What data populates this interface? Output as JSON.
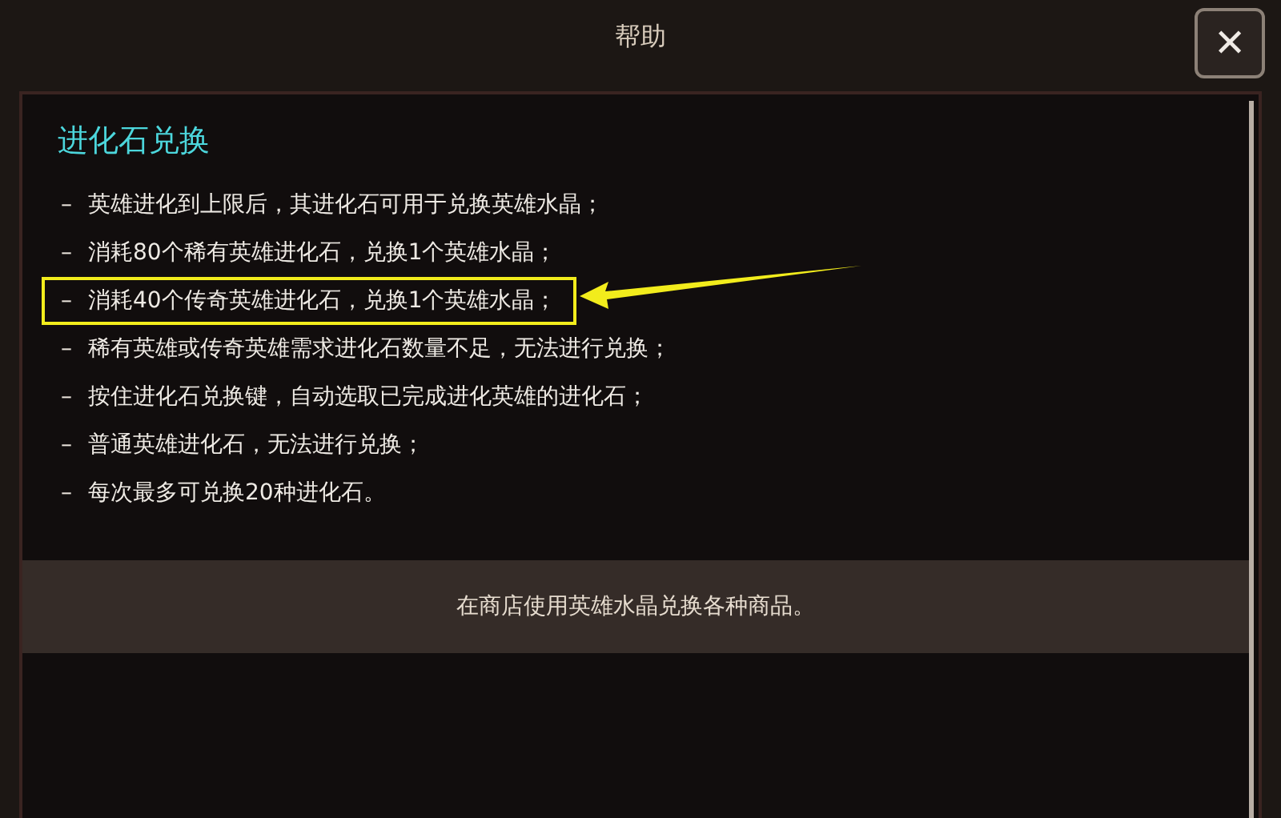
{
  "window": {
    "title": "帮助",
    "close": "✕"
  },
  "section": {
    "heading": "进化石兑换",
    "items": [
      {
        "bullet": "–",
        "text": "英雄进化到上限后，其进化石可用于兑换英雄水晶；",
        "highlighted": false
      },
      {
        "bullet": "–",
        "text": "消耗80个稀有英雄进化石，兑换1个英雄水晶；",
        "highlighted": false
      },
      {
        "bullet": "–",
        "text": "消耗40个传奇英雄进化石，兑换1个英雄水晶；",
        "highlighted": true
      },
      {
        "bullet": "–",
        "text": "稀有英雄或传奇英雄需求进化石数量不足，无法进行兑换；",
        "highlighted": false
      },
      {
        "bullet": "–",
        "text": "按住进化石兑换键，自动选取已完成进化英雄的进化石；",
        "highlighted": false
      },
      {
        "bullet": "–",
        "text": "普通英雄进化石，无法进行兑换；",
        "highlighted": false
      },
      {
        "bullet": "–",
        "text": "每次最多可兑换20种进化石。",
        "highlighted": false
      }
    ]
  },
  "footer": {
    "text": "在商店使用英雄水晶兑换各种商品。"
  }
}
